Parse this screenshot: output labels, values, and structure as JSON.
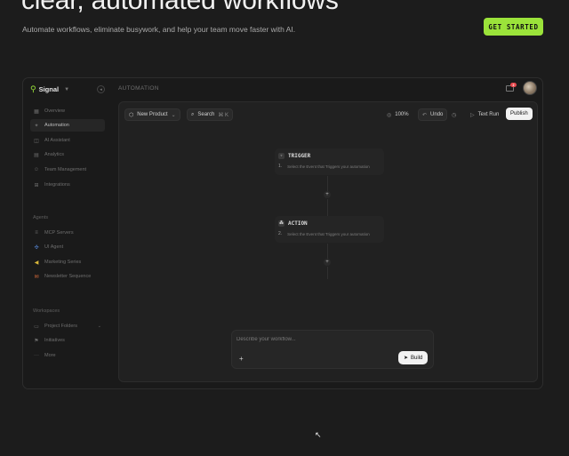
{
  "hero": {
    "title": "clear, automated workflows",
    "subtitle": "Automate workflows, eliminate busywork, and help your team move faster with AI.",
    "cta": "GET STARTED"
  },
  "app": {
    "brand": "Signal",
    "topbar_title": "AUTOMATION",
    "mail_badge": "2",
    "sidebar": {
      "main_items": [
        {
          "label": "Overview",
          "icon": "grid-icon"
        },
        {
          "label": "Automation",
          "icon": "sparkle-icon"
        },
        {
          "label": "AI Assistant",
          "icon": "chat-icon"
        },
        {
          "label": "Analytics",
          "icon": "chart-icon"
        },
        {
          "label": "Team Management",
          "icon": "users-icon"
        },
        {
          "label": "Integrations",
          "icon": "puzzle-icon"
        }
      ],
      "agents_label": "Agents",
      "agents": [
        {
          "label": "MCP Servers",
          "icon": "server-icon"
        },
        {
          "label": "UI Agent",
          "icon": "blue-agent-icon"
        },
        {
          "label": "Marketing Series",
          "icon": "megaphone-icon"
        },
        {
          "label": "Newsletter Sequence",
          "icon": "mail-icon"
        }
      ],
      "workspaces_label": "Workspaces",
      "workspaces": [
        {
          "label": "Project Folders",
          "icon": "folder-icon"
        },
        {
          "label": "Initiatives",
          "icon": "flag-icon"
        },
        {
          "label": "More",
          "icon": "more-icon"
        }
      ]
    },
    "toolbar": {
      "product": "New Product",
      "search": "Search",
      "search_shortcut": "⌘ K",
      "zoom": "100%",
      "undo": "Undo",
      "test_run": "Text Run",
      "publish": "Publish"
    },
    "nodes": [
      {
        "title": "TRIGGER",
        "num": "1.",
        "desc": "Select the Event that Triggers your automation"
      },
      {
        "title": "ACTION",
        "num": "2.",
        "desc": "Select the Event that Triggers your automation"
      }
    ],
    "prompt": {
      "placeholder": "Describe your workflow...",
      "build": "Build"
    }
  }
}
